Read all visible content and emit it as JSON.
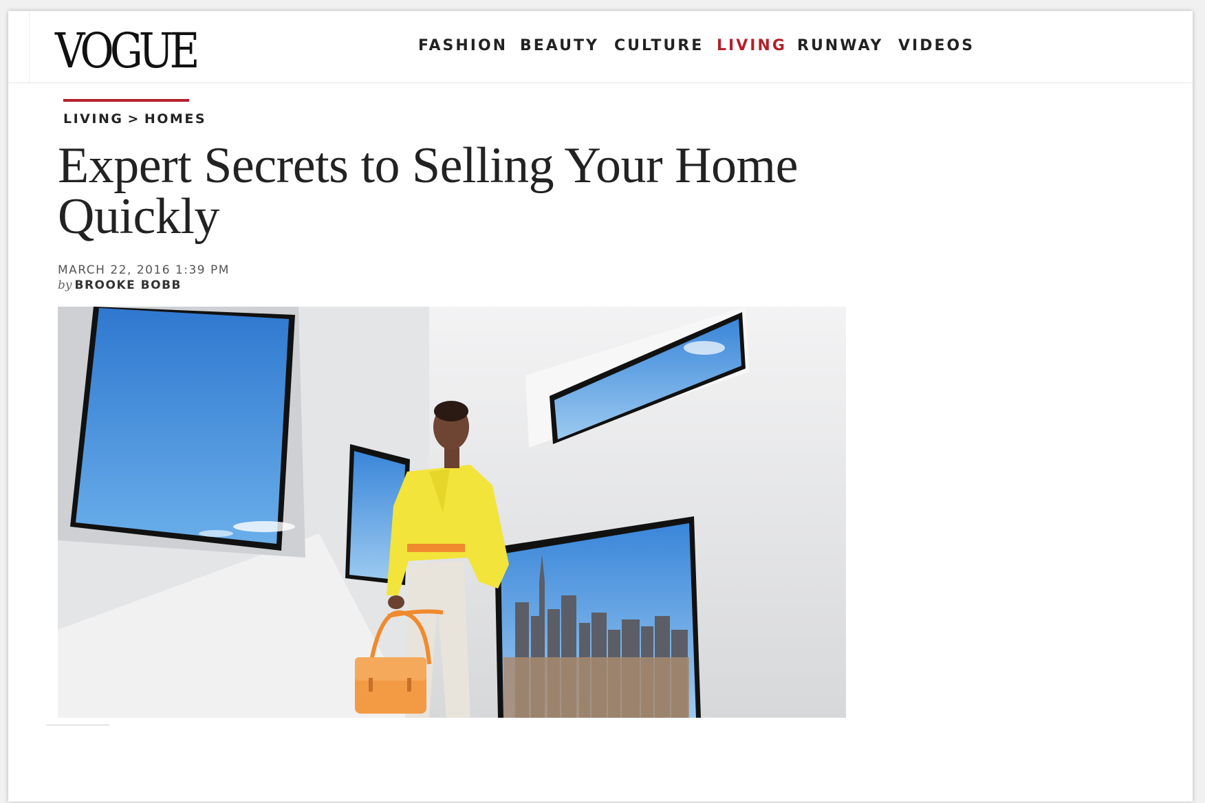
{
  "brand": {
    "logo_text": "VOGUE"
  },
  "nav": {
    "items": [
      {
        "label": "FASHION",
        "active": false
      },
      {
        "label": "BEAUTY",
        "active": false
      },
      {
        "label": "CULTURE",
        "active": false
      },
      {
        "label": "LIVING",
        "active": true
      },
      {
        "label": "RUNWAY",
        "active": false
      },
      {
        "label": "VIDEOS",
        "active": false
      }
    ]
  },
  "breadcrumb": {
    "section": "LIVING",
    "separator": ">",
    "subsection": "HOMES"
  },
  "article": {
    "title": "Expert Secrets to Selling Your Home Quickly",
    "date": "MARCH 22, 2016 1:39 PM",
    "byline_prefix": "by",
    "author": "BROOKE BOBB"
  },
  "colors": {
    "accent": "#b3202a",
    "text": "#222222",
    "shirt": "#f2e43a",
    "bag": "#f39a45",
    "sky": "#3d88d8"
  }
}
